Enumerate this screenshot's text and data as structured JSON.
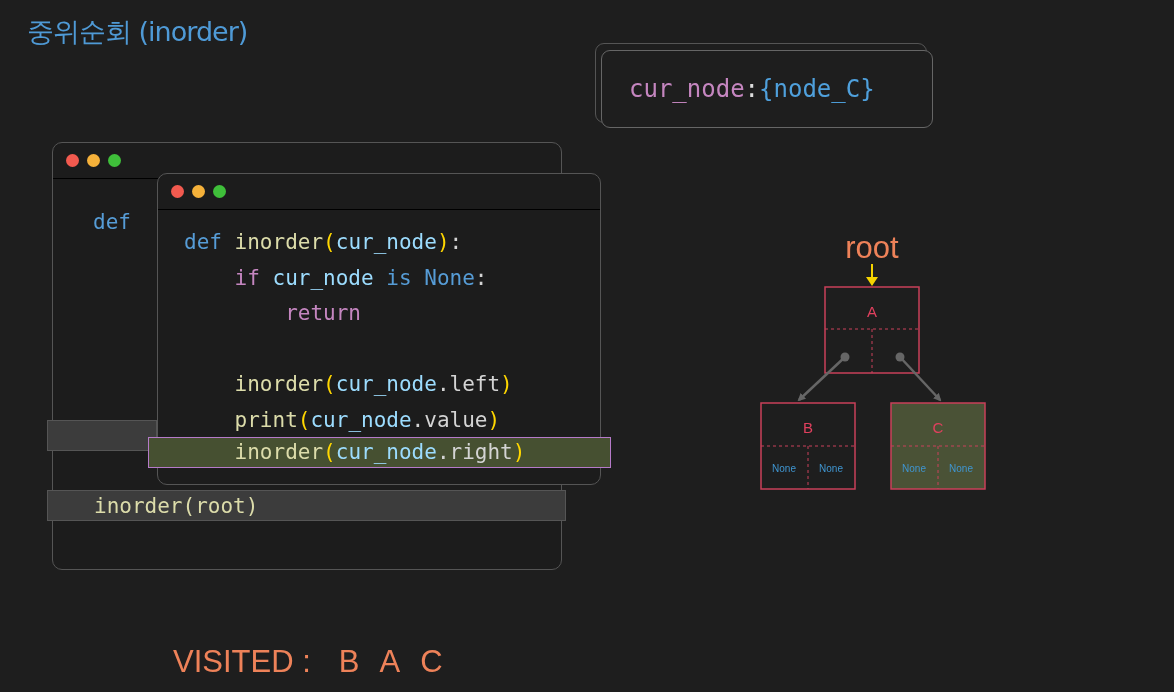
{
  "title": "중위순회 (inorder)",
  "variable_box": {
    "name": "cur_node",
    "separator": ":",
    "value": "{node_C}"
  },
  "back_window": {
    "lines": [
      {
        "text": "def",
        "highlighted": false
      },
      {
        "highlighted": true
      },
      {
        "text": "inorder(root)",
        "highlighted": true
      }
    ]
  },
  "code_window": {
    "lines": [
      {
        "highlighted": false,
        "tokens": [
          {
            "kind": "keyword",
            "text": "def"
          },
          {
            "kind": "function",
            "text": " inorder"
          },
          {
            "kind": "paren",
            "text": "("
          },
          {
            "kind": "variable",
            "text": "cur_node"
          },
          {
            "kind": "paren",
            "text": ")"
          },
          {
            "kind": "plain",
            "text": ":"
          }
        ]
      },
      {
        "highlighted": false,
        "tokens": [
          {
            "kind": "control",
            "text": "    if"
          },
          {
            "kind": "variable",
            "text": " cur_node"
          },
          {
            "kind": "keyword",
            "text": " is"
          },
          {
            "kind": "keyword",
            "text": " None"
          },
          {
            "kind": "plain",
            "text": ":"
          }
        ]
      },
      {
        "highlighted": false,
        "tokens": [
          {
            "kind": "control",
            "text": "        return"
          }
        ]
      },
      {
        "highlighted": false,
        "gap_before": true,
        "tokens": [
          {
            "kind": "function",
            "text": "    inorder"
          },
          {
            "kind": "paren",
            "text": "("
          },
          {
            "kind": "variable",
            "text": "cur_node"
          },
          {
            "kind": "plain",
            "text": ".left"
          },
          {
            "kind": "paren",
            "text": ")"
          }
        ]
      },
      {
        "highlighted": false,
        "tokens": [
          {
            "kind": "function",
            "text": "    print"
          },
          {
            "kind": "paren",
            "text": "("
          },
          {
            "kind": "variable",
            "text": "cur_node"
          },
          {
            "kind": "plain",
            "text": ".value"
          },
          {
            "kind": "paren",
            "text": ")"
          }
        ]
      },
      {
        "highlighted": true,
        "tokens": [
          {
            "kind": "function",
            "text": "    inorder"
          },
          {
            "kind": "paren",
            "text": "("
          },
          {
            "kind": "variable",
            "text": "cur_node"
          },
          {
            "kind": "plain",
            "text": ".right"
          },
          {
            "kind": "paren",
            "text": ")"
          }
        ]
      }
    ]
  },
  "tree": {
    "root_label": "root",
    "node": {
      "label": "A",
      "highlighted": false,
      "children": [
        {
          "label": "B",
          "highlighted": false,
          "slots": [
            "None",
            "None"
          ]
        },
        {
          "label": "C",
          "highlighted": true,
          "slots": [
            "None",
            "None"
          ]
        }
      ]
    }
  },
  "visited": {
    "label": "VISITED :",
    "values": [
      "B",
      "A",
      "C"
    ]
  }
}
